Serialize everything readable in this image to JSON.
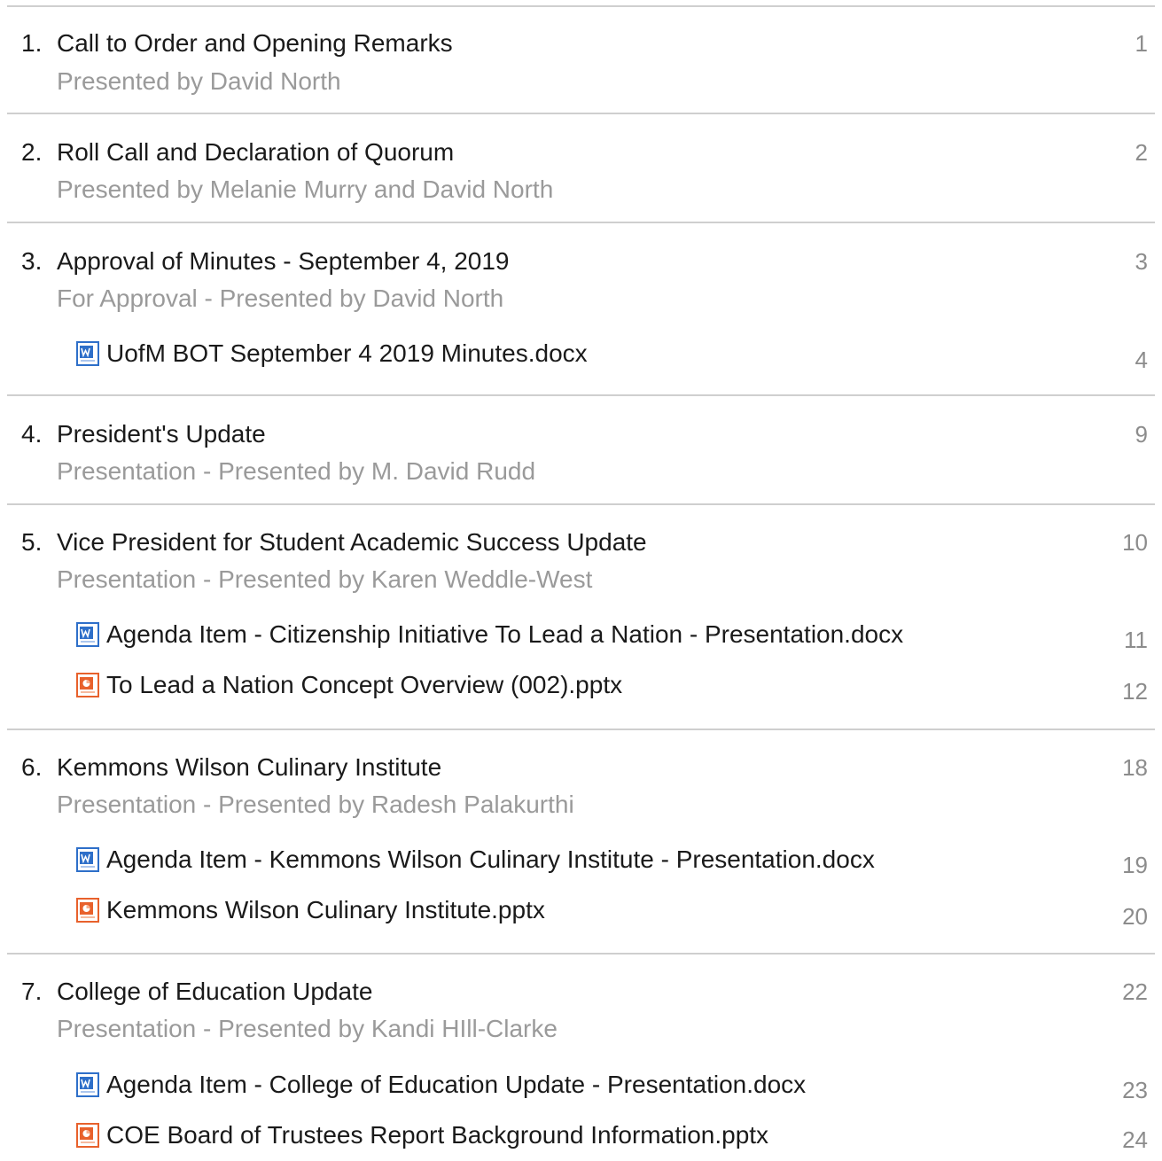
{
  "items": [
    {
      "number": "1.",
      "title": "Call to Order and Opening Remarks",
      "subtitle": "Presented by David North",
      "page": "1",
      "attachments": []
    },
    {
      "number": "2.",
      "title": "Roll Call and Declaration of Quorum",
      "subtitle": "Presented by Melanie Murry and David North",
      "page": "2",
      "attachments": []
    },
    {
      "number": "3.",
      "title": "Approval of Minutes - September 4, 2019",
      "subtitle": "For Approval - Presented by David North",
      "page": "3",
      "attachments": [
        {
          "name": "UofM BOT September 4 2019 Minutes.docx",
          "icon": "word-document-icon",
          "page": "4"
        }
      ]
    },
    {
      "number": "4.",
      "title": "President's Update",
      "subtitle": "Presentation - Presented by M. David Rudd",
      "page": "9",
      "attachments": []
    },
    {
      "number": "5.",
      "title": "Vice President for Student Academic Success Update",
      "subtitle": "Presentation - Presented by Karen Weddle-West",
      "page": "10",
      "attachments": [
        {
          "name": "Agenda Item - Citizenship Initiative To Lead a Nation - Presentation.docx",
          "icon": "word-document-icon",
          "page": "11"
        },
        {
          "name": "To Lead a Nation Concept Overview (002).pptx",
          "icon": "powerpoint-document-icon",
          "page": "12"
        }
      ]
    },
    {
      "number": "6.",
      "title": "Kemmons Wilson Culinary Institute",
      "subtitle": "Presentation - Presented by Radesh Palakurthi",
      "page": "18",
      "attachments": [
        {
          "name": "Agenda Item - Kemmons Wilson Culinary Institute - Presentation.docx",
          "icon": "word-document-icon",
          "page": "19"
        },
        {
          "name": "Kemmons Wilson Culinary Institute.pptx",
          "icon": "powerpoint-document-icon",
          "page": "20"
        }
      ]
    },
    {
      "number": "7.",
      "title": "College of Education Update",
      "subtitle": "Presentation - Presented by Kandi HIll-Clarke",
      "page": "22",
      "attachments": [
        {
          "name": "Agenda Item - College of Education Update - Presentation.docx",
          "icon": "word-document-icon",
          "page": "23"
        },
        {
          "name": "COE Board of Trustees Report Background Information.pptx",
          "icon": "powerpoint-document-icon",
          "page": "24"
        }
      ]
    }
  ],
  "colors": {
    "divider": "#cfcfcf",
    "text": "#1a1a1a",
    "subtitle": "#9a9a9a",
    "page_number": "#8c8c8c",
    "word_icon": "#2e6fc9",
    "powerpoint_icon": "#e8612c"
  }
}
